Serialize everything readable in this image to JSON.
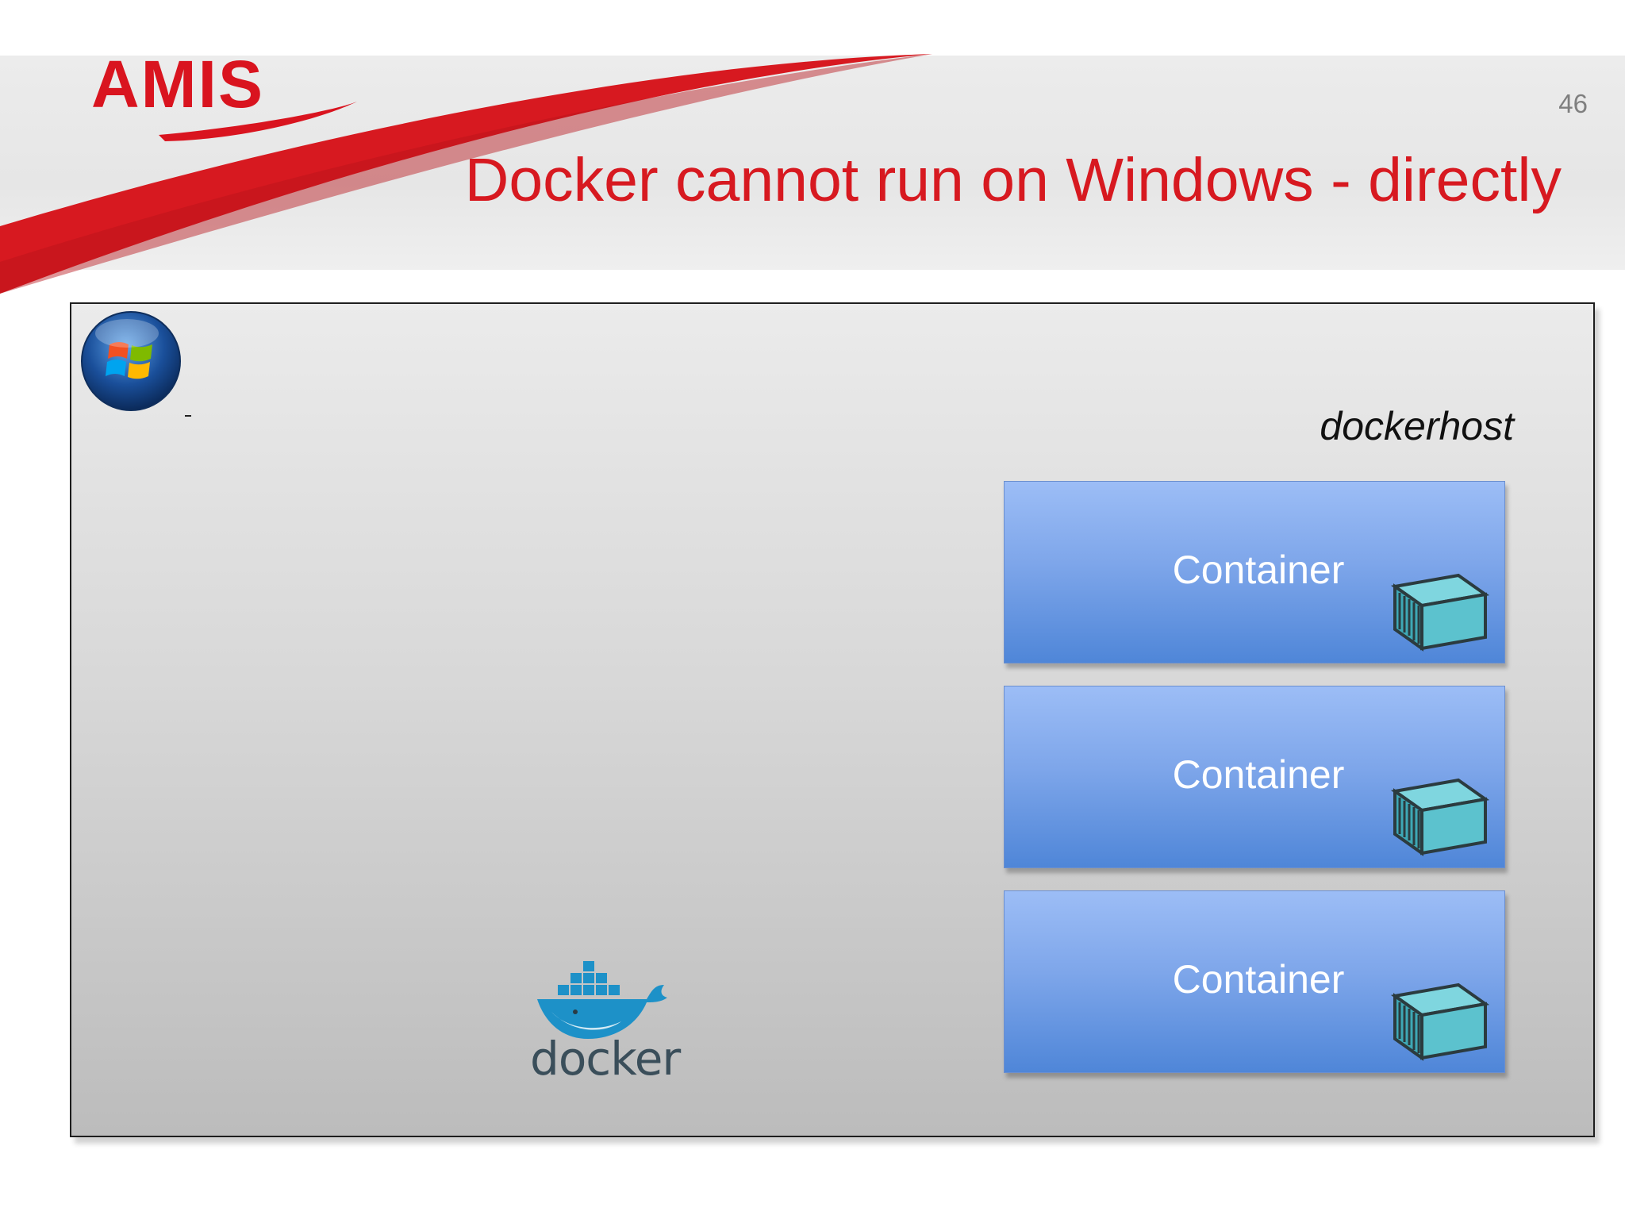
{
  "slide": {
    "brand": "AMIS",
    "number": "46",
    "title": "Docker cannot run on Windows - directly"
  },
  "diagram": {
    "host_label": "dockerhost",
    "containers": [
      {
        "label": "Container"
      },
      {
        "label": "Container"
      },
      {
        "label": "Container"
      }
    ],
    "docker_logo_text": "docker",
    "icons": [
      "windows-logo-icon",
      "docker-whale-icon",
      "shipping-container-icon"
    ]
  },
  "colors": {
    "brand_red": "#d71920",
    "container_blue": "#6d9ae5",
    "host_gray": "#d0d0d0",
    "docker_blue": "#1d91c8"
  }
}
